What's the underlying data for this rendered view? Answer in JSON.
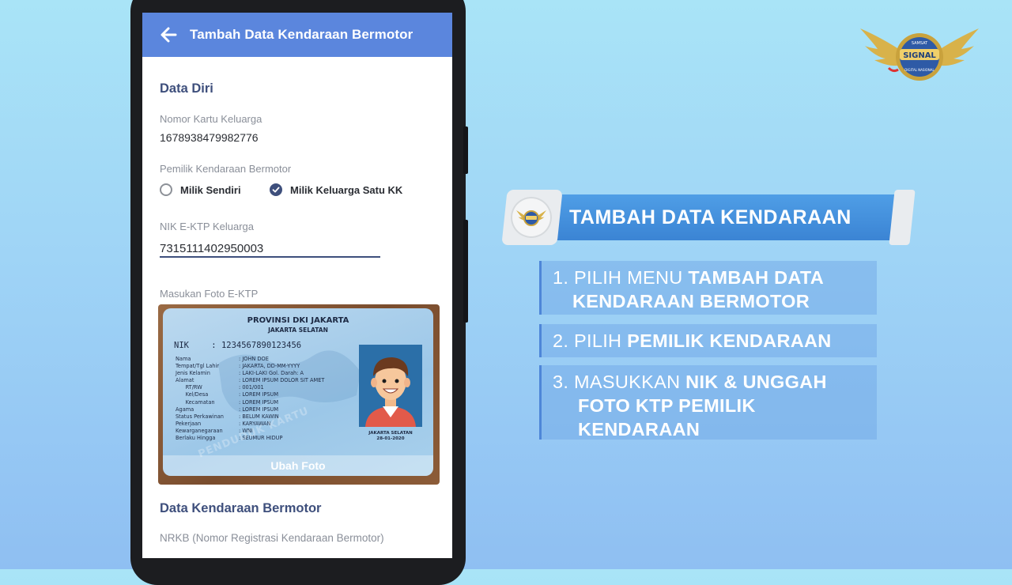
{
  "app": {
    "title": "Tambah Data Kendaraan Bermotor"
  },
  "form": {
    "section_personal": "Data Diri",
    "kk_label": "Nomor Kartu Keluarga",
    "kk_value": "1678938479982776",
    "owner_label": "Pemilik Kendaraan Bermotor",
    "owner_options": [
      {
        "label": "Milik Sendiri",
        "checked": false
      },
      {
        "label": "Milik Keluarga Satu KK",
        "checked": true
      }
    ],
    "nik_label": "NIK E-KTP Keluarga",
    "nik_value": "7315111402950003",
    "photo_label": "Masukan Foto E-KTP",
    "photo_overlay": "Ubah Foto",
    "section_vehicle": "Data Kendaraan Bermotor",
    "nrkb_label": "NRKB (Nomor Registrasi Kendaraan Bermotor)"
  },
  "ktp": {
    "province": "PROVINSI DKI JAKARTA",
    "city": "JAKARTA SELATAN",
    "nik_label": "NIK",
    "nik_value": ":   1234567890123456",
    "rows": [
      [
        "Nama",
        ": JOHN DOE"
      ],
      [
        "Tempat/Tgl Lahir",
        ": JAKARTA, DD-MM-YYYY"
      ],
      [
        "Jenis Kelamin",
        ": LAKI-LAKI        Gol. Darah: A"
      ],
      [
        "Alamat",
        ": LOREM IPSUM DOLOR SIT AMET"
      ],
      [
        "      RT/RW",
        ": 001/001"
      ],
      [
        "      Kel/Desa",
        ": LOREM IPSUM"
      ],
      [
        "      Kecamatan",
        ": LOREM IPSUM"
      ],
      [
        "Agama",
        ": LOREM IPSUM"
      ],
      [
        "Status Perkawinan",
        ": BELUM KAWIN"
      ],
      [
        "Pekerjaan",
        ": KARYAWAN"
      ],
      [
        "Kewarganegaraan",
        ": WNI"
      ],
      [
        "Berlaku Hingga",
        ": SEUMUR HIDUP"
      ]
    ],
    "issue_place": "JAKARTA SELATAN",
    "issue_date": "28-01-2020",
    "watermark": "PENDUDUK  KARTU"
  },
  "guide": {
    "banner_title": "TAMBAH DATA KENDARAAN",
    "steps": [
      {
        "num": "1.",
        "pre": "PILIH MENU ",
        "bold1": "TAMBAH DATA",
        "bold2": "KENDARAAN BERMOTOR"
      },
      {
        "num": "2.",
        "pre": "PILIH ",
        "bold1": "PEMILIK KENDARAAN"
      },
      {
        "num": "3.",
        "pre": "MASUKKAN ",
        "bold1": "NIK & UNGGAH",
        "bold2": "FOTO KTP PEMILIK",
        "bold3": "KENDARAAN"
      }
    ]
  },
  "logo": {
    "text_top": "SAMSAT",
    "text_main": "SIGNAL",
    "text_bottom": "DIGITAL NASIONAL"
  },
  "colors": {
    "appbar": "#5b86dd",
    "heading": "#3e4f7c",
    "banner": "#3b84d4"
  }
}
